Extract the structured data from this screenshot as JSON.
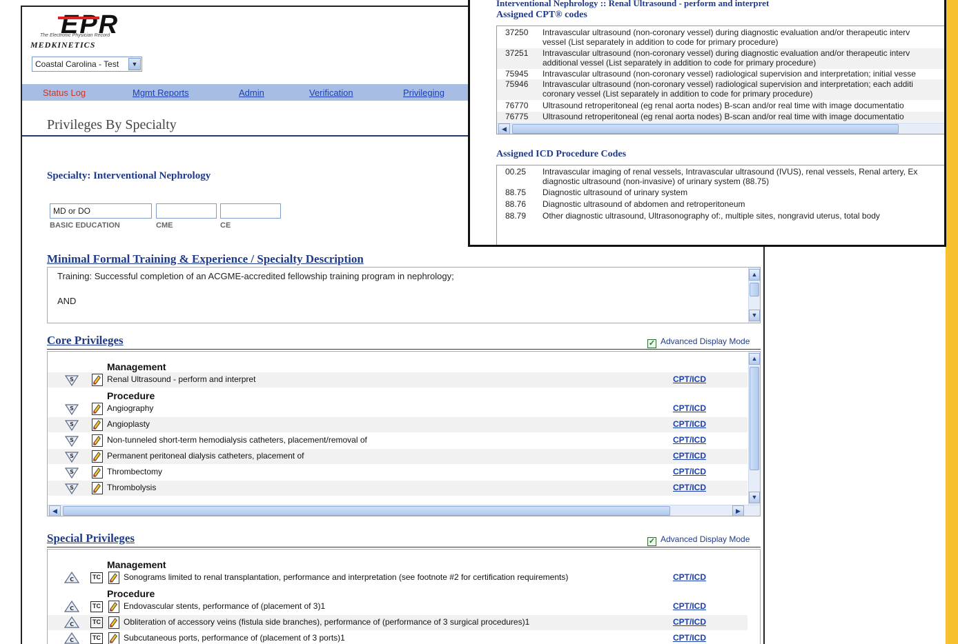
{
  "header": {
    "logo_text": "EPR",
    "logo_subtitle": "The Electronic Physician Record",
    "brand": "MEDKINETICS",
    "org_select": "Coastal Carolina - Test"
  },
  "nav": [
    {
      "label": "Status Log"
    },
    {
      "label": "Mgmt Reports"
    },
    {
      "label": "Admin"
    },
    {
      "label": "Verification"
    },
    {
      "label": "Privileging"
    }
  ],
  "page": {
    "title": "Privileges By Specialty",
    "specialty": "Specialty: Interventional Nephrology",
    "education": {
      "basic_value": "MD or DO",
      "cme_value": "",
      "ce_value": "",
      "basic_label": "BASIC EDUCATION",
      "cme_label": "CME",
      "ce_label": "CE"
    }
  },
  "training": {
    "heading": "Minimal Formal Training & Experience / Specialty Description",
    "line1": "Training:  Successful completion of an ACGME-accredited fellowship training program in nephrology;",
    "line2": "AND"
  },
  "core": {
    "heading": "Core Privileges",
    "adv_label": "Advanced Display Mode",
    "adv_checked": true,
    "groups": {
      "management": "Management",
      "procedure": "Procedure"
    },
    "link_label": "CPT/ICD",
    "items": [
      {
        "text": "Renal Ultrasound - perform and interpret"
      },
      {
        "text": "Angiography"
      },
      {
        "text": "Angioplasty"
      },
      {
        "text": "Non-tunneled short-term hemodialysis catheters, placement/removal of"
      },
      {
        "text": "Permanent peritoneal dialysis catheters, placement of"
      },
      {
        "text": "Thrombectomy"
      },
      {
        "text": "Thrombolysis"
      }
    ]
  },
  "special": {
    "heading": "Special Privileges",
    "adv_label": "Advanced Display Mode",
    "adv_checked": true,
    "groups": {
      "management": "Management",
      "procedure": "Procedure"
    },
    "link_label": "CPT/ICD",
    "tc_label": "TC",
    "items": [
      {
        "text": "Sonograms limited to renal transplantation, performance and interpretation (see footnote #2 for certification requirements)"
      },
      {
        "text": "Endovascular stents, performance of (placement of 3)1"
      },
      {
        "text": "Obliteration of accessory veins (fistula side branches), performance of (performance of 3 surgical procedures)1"
      },
      {
        "text": "Subcutaneous ports, performance of (placement of 3 ports)1"
      }
    ]
  },
  "popup": {
    "title": "Interventional Nephrology :: Renal Ultrasound - perform and interpret",
    "cpt_heading": "Assigned CPT® codes",
    "cpt": [
      {
        "code": "37250",
        "desc": "Intravascular ultrasound (non-coronary vessel) during diagnostic evaluation and/or therapeutic interv\nvessel (List separately in addition to code for primary procedure)"
      },
      {
        "code": "37251",
        "desc": "Intravascular ultrasound (non-coronary vessel) during diagnostic evaluation and/or therapeutic interv\nadditional vessel (List separately in addition to code for primary procedure)"
      },
      {
        "code": "75945",
        "desc": "Intravascular ultrasound (non-coronary vessel) radiological supervision and interpretation; initial vesse"
      },
      {
        "code": "75946",
        "desc": "Intravascular ultrasound (non-coronary vessel) radiological supervision and interpretation; each additi\ncoronary vessel (List separately in addition to code for primary procedure)"
      },
      {
        "code": "76770",
        "desc": "Ultrasound retroperitoneal (eg renal aorta nodes) B-scan and/or real time with image documentatio"
      },
      {
        "code": "76775",
        "desc": "Ultrasound retroperitoneal (eg renal aorta nodes) B-scan and/or real time with image documentatio"
      }
    ],
    "icd_heading": "Assigned ICD Procedure Codes",
    "icd": [
      {
        "code": "00.25",
        "desc": "Intravascular imaging of renal vessels, Intravascular ultrasound (IVUS), renal vessels, Renal artery, Ex\ndiagnostic ultrasound (non-invasive) of urinary system (88.75)"
      },
      {
        "code": "88.75",
        "desc": "Diagnostic ultrasound of urinary system"
      },
      {
        "code": "88.76",
        "desc": "Diagnostic ultrasound of abdomen and retroperitoneum"
      },
      {
        "code": "88.79",
        "desc": "Other diagnostic ultrasound, Ultrasonography of:, multiple sites, nongravid uterus, total body"
      }
    ]
  },
  "colors": {
    "accent_yellow": "#f6c02e",
    "nav_blue": "#a8bde3",
    "heading_blue": "#1f3a8a",
    "link_blue": "#1a3fb0",
    "status_red": "#c0392b"
  }
}
